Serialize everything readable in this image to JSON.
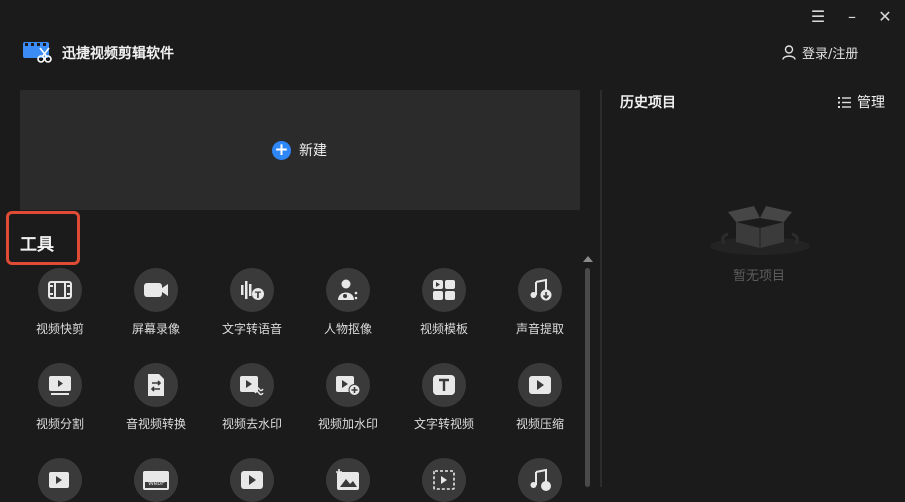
{
  "app": {
    "title": "迅捷视频剪辑软件"
  },
  "window_controls": {
    "menu": "☰",
    "minimize": "–",
    "close": "✕"
  },
  "header": {
    "login_label": "登录/注册"
  },
  "new_project": {
    "label": "新建",
    "plus": "+"
  },
  "tools": {
    "title": "工具",
    "items": [
      {
        "label": "视频快剪",
        "icon": "film-icon"
      },
      {
        "label": "屏幕录像",
        "icon": "camera-icon"
      },
      {
        "label": "文字转语音",
        "icon": "text-to-speech-icon"
      },
      {
        "label": "人物抠像",
        "icon": "person-cutout-icon"
      },
      {
        "label": "视频模板",
        "icon": "template-icon"
      },
      {
        "label": "声音提取",
        "icon": "audio-extract-icon"
      },
      {
        "label": "视频分割",
        "icon": "video-split-icon"
      },
      {
        "label": "音视频转换",
        "icon": "convert-icon"
      },
      {
        "label": "视频去水印",
        "icon": "remove-watermark-icon"
      },
      {
        "label": "视频加水印",
        "icon": "add-watermark-icon"
      },
      {
        "label": "文字转视频",
        "icon": "text-to-video-icon"
      },
      {
        "label": "视频压缩",
        "icon": "compress-icon"
      }
    ],
    "partial_row_icons": [
      "video-extra-icon",
      "webp-icon",
      "play-icon",
      "image-icon",
      "crop-icon",
      "music-icon"
    ],
    "webp_badge": "WebP"
  },
  "history": {
    "title": "历史项目",
    "manage_label": "管理",
    "empty_text": "暂无项目"
  },
  "colors": {
    "accent": "#2f86f6",
    "highlight_box": "#e04b36",
    "background": "#1b1b1c"
  }
}
